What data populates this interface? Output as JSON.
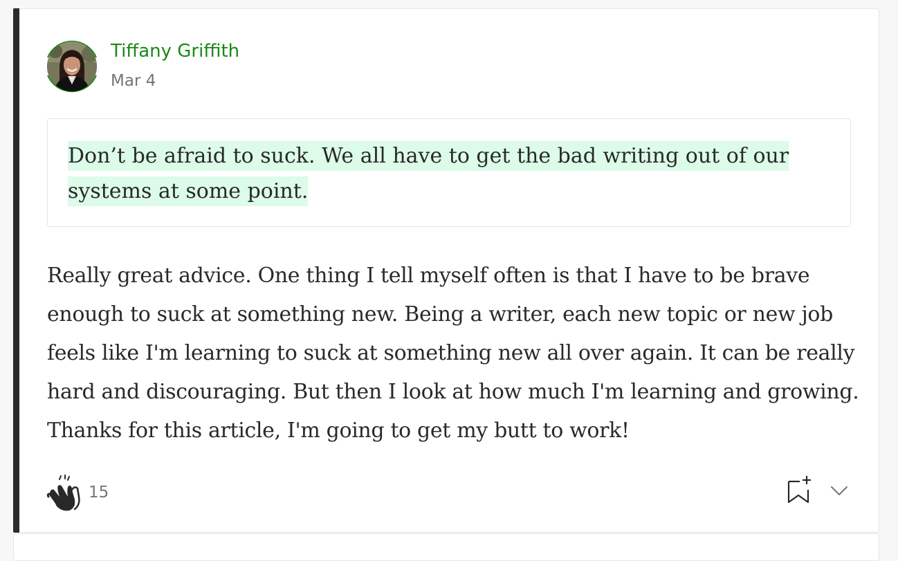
{
  "response": {
    "author": {
      "name": "Tiffany Griffith",
      "date": "Mar 4",
      "avatar_icon": "author-avatar-photo"
    },
    "quote": {
      "text": "Don’t be afraid to suck. We all have to get the bad writing out of our systems at some point."
    },
    "body": {
      "text": "Really great advice. One thing I tell myself often is that I have to be brave enough to suck at something new. Being a writer, each new topic or new job feels like I'm learning to suck at something new all over again. It can be really hard and discouraging. But then I look at how much I'm learning and growing. Thanks for this article, I'm going to get my butt to work!"
    },
    "actions": {
      "clap_icon": "clap-icon",
      "clap_count": "15",
      "bookmark_icon": "bookmark-add-icon",
      "more_icon": "chevron-down-icon"
    }
  },
  "colors": {
    "author_name": "#1a8917",
    "highlight": "#dcfbe9",
    "text": "#292929",
    "muted": "#757575",
    "accent_bar": "#2b2b2b"
  }
}
